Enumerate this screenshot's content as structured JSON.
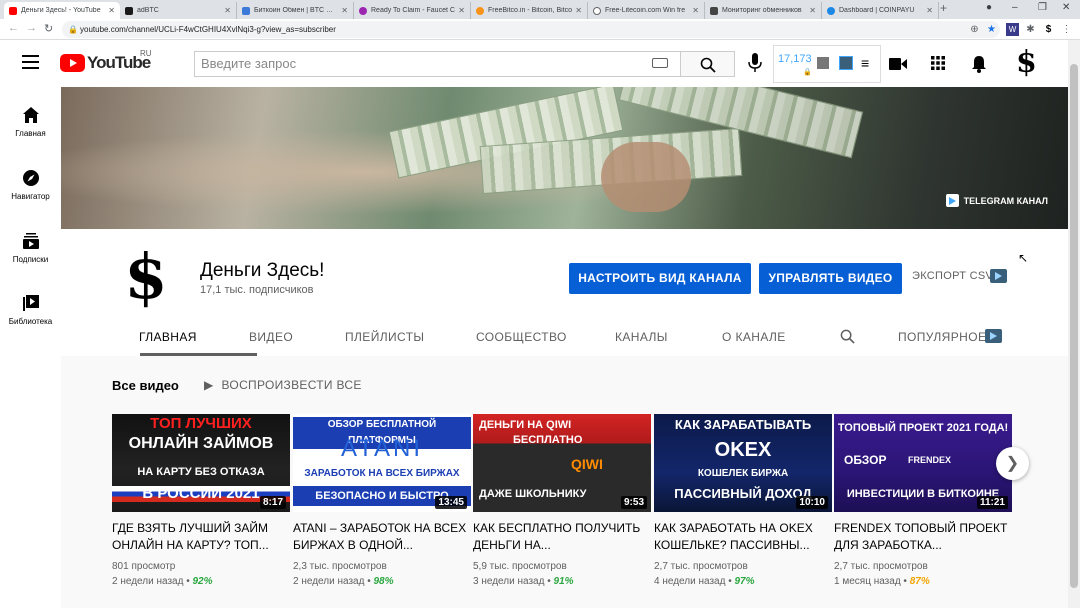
{
  "browser": {
    "tabs": [
      {
        "title": "Деньги Здесь! - YouTube",
        "color": "#ff0000"
      },
      {
        "title": "adBTC",
        "color": "#1a1a1a"
      },
      {
        "title": "Биткоин Обмен | BTC Обм",
        "color": "#3c7ad9"
      },
      {
        "title": "Ready To Claim - Faucet C",
        "color": "#9c27b0"
      },
      {
        "title": "FreeBitco.in - Bitcoin, Bitco",
        "color": "#f7931a"
      },
      {
        "title": "Free-Litecoin.com Win fre",
        "color": "#666666"
      },
      {
        "title": "Мониторинг обменников",
        "color": "#444444"
      },
      {
        "title": "Dashboard | COINPAYU",
        "color": "#1e88e5"
      }
    ],
    "url": "youtube.com/channel/UCLi-F4wCtGHIU4XvlNqi3-g?view_as=subscriber"
  },
  "header": {
    "logo_text": "YouTube",
    "region": "RU",
    "search_placeholder": "Введите запрос",
    "ext_count": "17,173",
    "avatar_symbol": "$"
  },
  "sidebar": {
    "items": [
      {
        "label": "Главная"
      },
      {
        "label": "Навигатор"
      },
      {
        "label": "Подписки"
      },
      {
        "label": "Библиотека"
      }
    ]
  },
  "banner": {
    "telegram_label": "TELEGRAM КАНАЛ"
  },
  "channel": {
    "avatar_symbol": "$",
    "name": "Деньги Здесь!",
    "subscribers": "17,1 тыс. подписчиков",
    "customize_btn": "НАСТРОИТЬ ВИД КАНАЛА",
    "manage_btn": "УПРАВЛЯТЬ ВИДЕО",
    "export_label": "ЭКСПОРТ CSV"
  },
  "tabs": [
    {
      "label": "ГЛАВНАЯ"
    },
    {
      "label": "ВИДЕО"
    },
    {
      "label": "ПЛЕЙЛИСТЫ"
    },
    {
      "label": "СООБЩЕСТВО"
    },
    {
      "label": "КАНАЛЫ"
    },
    {
      "label": "О КАНАЛЕ"
    },
    {
      "label": "ПОПУЛЯРНОЕ"
    }
  ],
  "section": {
    "title": "Все видео",
    "play_all": "ВОСПРОИЗВЕСТИ ВСЕ"
  },
  "videos": [
    {
      "thumb_lines": [
        "ТОП ЛУЧШИХ",
        "ОНЛАЙН ЗАЙМОВ",
        "НА КАРТУ БЕЗ ОТКАЗА",
        "В РОССИИ 2021"
      ],
      "duration": "8:17",
      "title": "ГДЕ ВЗЯТЬ ЛУЧШИЙ ЗАЙМ ОНЛАЙН НА КАРТУ? ТОП...",
      "views": "801 просмотр",
      "age": "2 недели назад",
      "pct": "92%",
      "pct_color": "#2ba640"
    },
    {
      "thumb_lines": [
        "ОБЗОР БЕСПЛАТНОЙ ПЛАТФОРМЫ",
        "ATANI",
        "ЗАРАБОТОК НА ВСЕХ БИРЖАХ",
        "БЕЗОПАСНО И БЫСТРО"
      ],
      "duration": "13:45",
      "title": "ATANI – ЗАРАБОТОК НА ВСЕХ БИРЖАХ В ОДНОЙ...",
      "views": "2,3 тыс. просмотров",
      "age": "2 недели назад",
      "pct": "98%",
      "pct_color": "#2ba640"
    },
    {
      "thumb_lines": [
        "ДЕНЬГИ НА QIWI",
        "БЕСПЛАТНО",
        "QIWI",
        "ДАЖЕ ШКОЛЬНИКУ"
      ],
      "duration": "9:53",
      "title": "КАК БЕСПЛАТНО ПОЛУЧИТЬ ДЕНЬГИ НА...",
      "views": "5,9 тыс. просмотров",
      "age": "3 недели назад",
      "pct": "91%",
      "pct_color": "#2ba640"
    },
    {
      "thumb_lines": [
        "КАК ЗАРАБАТЫВАТЬ",
        "OKEX",
        "КОШЕЛЕК БИРЖА",
        "ПАССИВНЫЙ ДОХОД"
      ],
      "duration": "10:10",
      "title": "КАК ЗАРАБОТАТЬ НА OKEX КОШЕЛЬКЕ? ПАССИВНЫ...",
      "views": "2,7 тыс. просмотров",
      "age": "4 недели назад",
      "pct": "97%",
      "pct_color": "#2ba640"
    },
    {
      "thumb_lines": [
        "ТОПОВЫЙ ПРОЕКТ 2021 ГОДА!",
        "ОБЗОР",
        "FRENDEX",
        "ИНВЕСТИЦИИ В БИТКОИНЕ"
      ],
      "duration": "11:21",
      "title": "FRENDEX ТОПОВЫЙ ПРОЕКТ ДЛЯ ЗАРАБОТКА...",
      "views": "2,7 тыс. просмотров",
      "age": "1 месяц назад",
      "pct": "87%",
      "pct_color": "#f2a500"
    }
  ]
}
